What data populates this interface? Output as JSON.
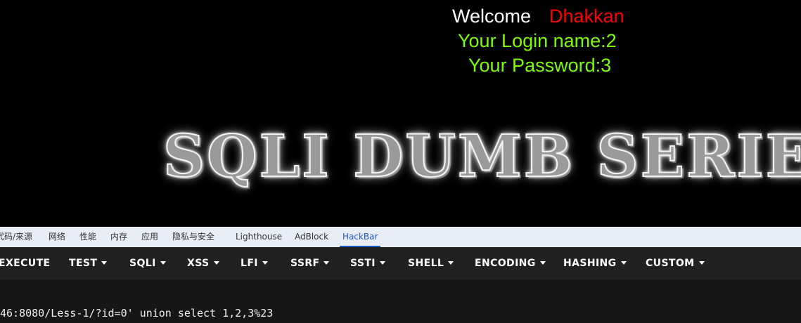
{
  "page": {
    "welcome": "Welcome",
    "user_name": "Dhakkan",
    "login_line": "Your Login name:2",
    "password_line": "Your Password:3",
    "banner": "SQLI DUMB SERIE"
  },
  "devtools": {
    "tabs": [
      {
        "label": "代码/来源",
        "active": false
      },
      {
        "label": "网络",
        "active": false
      },
      {
        "label": "性能",
        "active": false
      },
      {
        "label": "内存",
        "active": false
      },
      {
        "label": "应用",
        "active": false
      },
      {
        "label": "隐私与安全",
        "active": false
      },
      {
        "label": "Lighthouse",
        "active": false
      },
      {
        "label": "AdBlock",
        "active": false
      },
      {
        "label": "HackBar",
        "active": true
      }
    ]
  },
  "hackbar": {
    "buttons": [
      {
        "label": "EXECUTE",
        "dropdown": false
      },
      {
        "label": "TEST",
        "dropdown": true
      },
      {
        "label": "SQLI",
        "dropdown": true
      },
      {
        "label": "XSS",
        "dropdown": true
      },
      {
        "label": "LFI",
        "dropdown": true
      },
      {
        "label": "SSRF",
        "dropdown": true
      },
      {
        "label": "SSTI",
        "dropdown": true
      },
      {
        "label": "SHELL",
        "dropdown": true
      },
      {
        "label": "ENCODING",
        "dropdown": true
      },
      {
        "label": "HASHING",
        "dropdown": true
      },
      {
        "label": "CUSTOM",
        "dropdown": true
      }
    ],
    "url_value": "46:8080/Less-1/?id=0' union select 1,2,3%23"
  },
  "colors": {
    "welcome": "#ffffff",
    "user_name": "#ff0000",
    "info_text": "#7cfc00",
    "toolbar_bg": "#212121",
    "active_tab": "#1a57c7"
  }
}
